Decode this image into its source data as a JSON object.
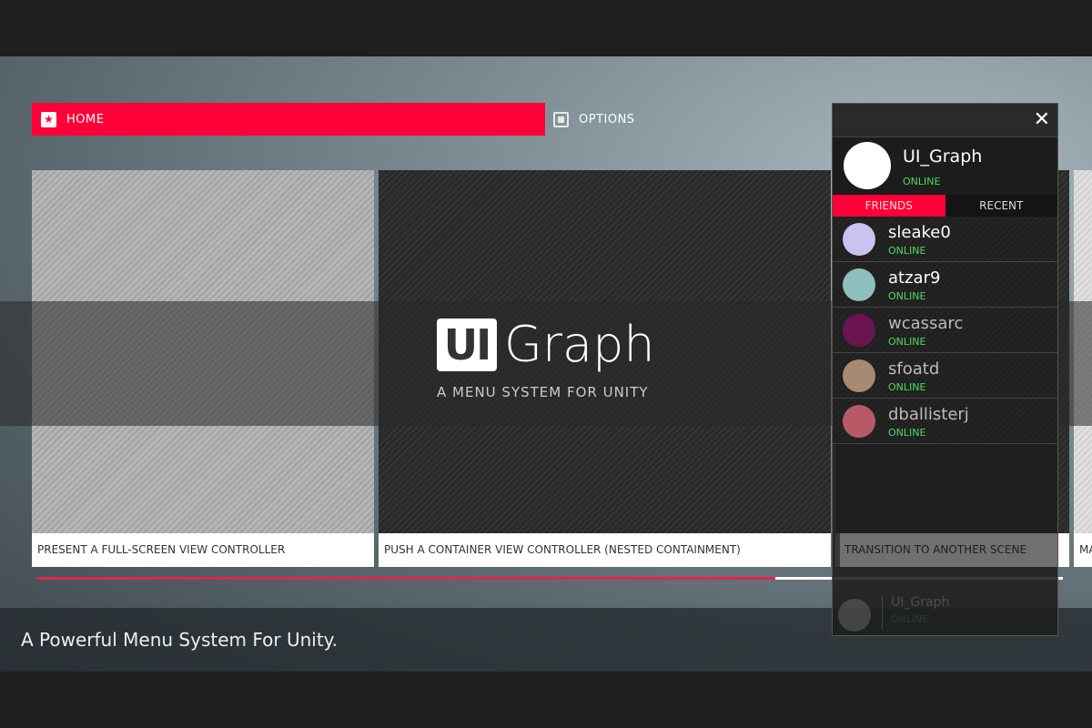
{
  "nav": {
    "home": "HOME",
    "options": "OPTIONS"
  },
  "cards": [
    {
      "caption": "PRESENT A FULL-SCREEN VIEW CONTROLLER"
    },
    {
      "caption": "PUSH A CONTAINER VIEW CONTROLLER (NESTED CONTAINMENT)"
    },
    {
      "caption": "TRANSITION TO ANOTHER SCENE"
    },
    {
      "caption": "MA"
    }
  ],
  "logo": {
    "mark": "UI",
    "word": "Graph",
    "tagline": "A MENU SYSTEM FOR UNITY"
  },
  "progress": 0.72,
  "footer": "A Powerful Menu System For Unity.",
  "panel": {
    "user": {
      "name": "UI_Graph",
      "status": "ONLINE"
    },
    "tabs": {
      "friends": "FRIENDS",
      "recent": "RECENT"
    },
    "friends": [
      {
        "name": "sleake0",
        "status": "ONLINE",
        "color": "#cbc3ef"
      },
      {
        "name": "atzar9",
        "status": "ONLINE",
        "color": "#8fbfbd"
      },
      {
        "name": "wcassarc",
        "status": "ONLINE",
        "color": "#6a1450"
      },
      {
        "name": "sfoatd",
        "status": "ONLINE",
        "color": "#a88a72"
      },
      {
        "name": "dballisterj",
        "status": "ONLINE",
        "color": "#b85a65"
      }
    ]
  }
}
